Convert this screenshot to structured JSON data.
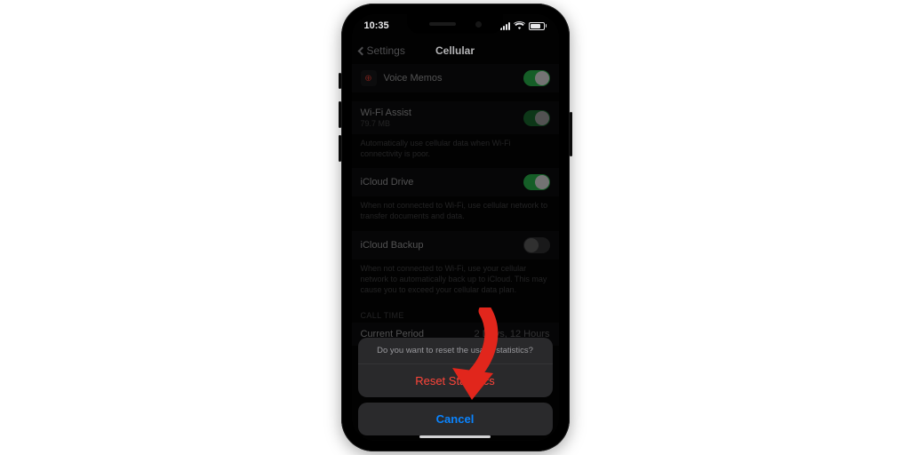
{
  "status": {
    "time": "10:35",
    "battery_pct": "83"
  },
  "nav": {
    "back_label": "Settings",
    "title": "Cellular"
  },
  "rows": {
    "voice_memos": {
      "label": "Voice Memos",
      "icon_glyph": "⊕"
    },
    "wifi_assist": {
      "label": "Wi-Fi Assist",
      "sub": "79.7 MB",
      "footer": "Automatically use cellular data when Wi-Fi connectivity is poor."
    },
    "icloud_drive": {
      "label": "iCloud Drive",
      "footer": "When not connected to Wi-Fi, use cellular network to transfer documents and data."
    },
    "icloud_backup": {
      "label": "iCloud Backup",
      "footer": "When not connected to Wi-Fi, use your cellular network to automatically back up to iCloud. This may cause you to exceed your cellular data plan."
    }
  },
  "call_time": {
    "header": "CALL TIME",
    "current_period": {
      "k": "Current Period",
      "v": "2 Days, 12 Hours"
    }
  },
  "sheet": {
    "message": "Do you want to reset the usage statistics?",
    "reset": "Reset Statistics",
    "cancel": "Cancel"
  }
}
